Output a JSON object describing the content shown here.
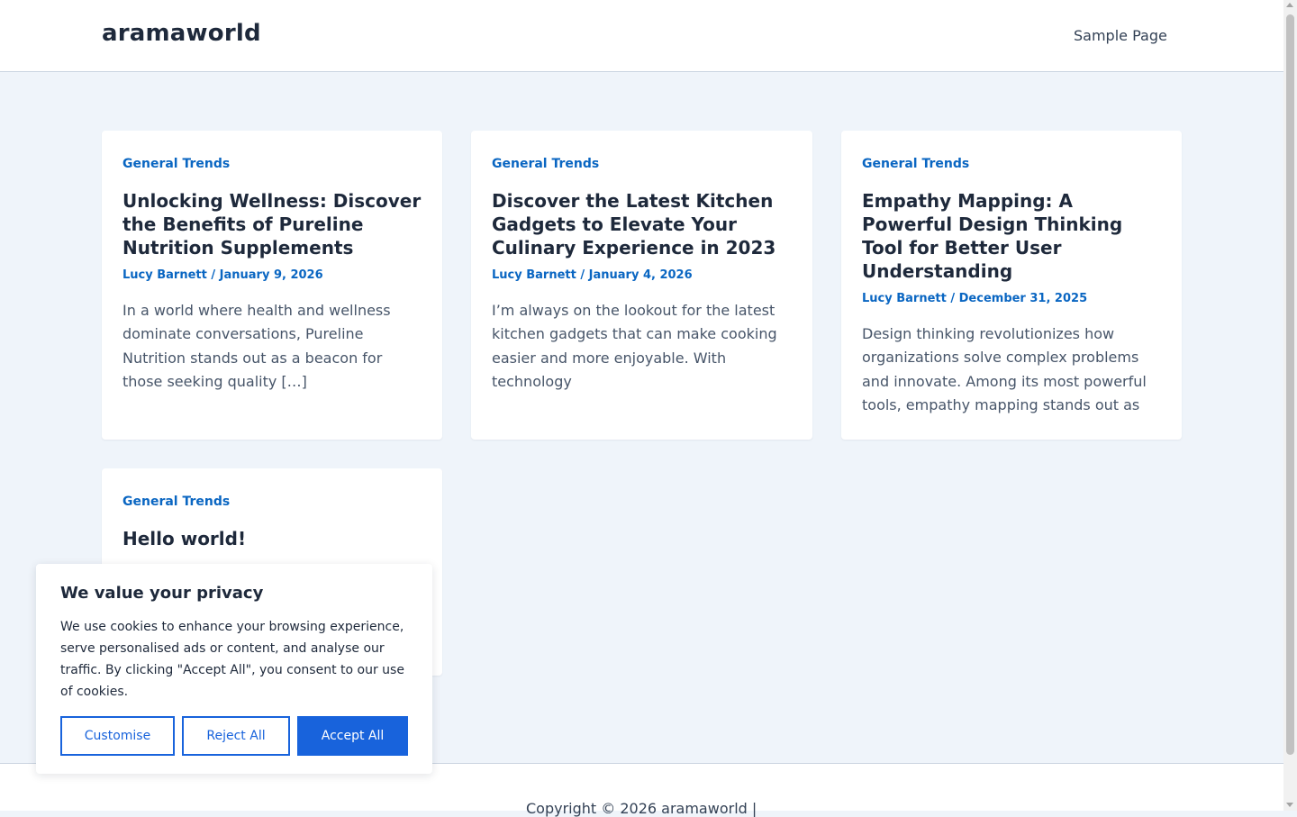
{
  "header": {
    "site_title": "aramaworld",
    "nav": [
      {
        "label": "Sample Page"
      }
    ]
  },
  "posts": [
    {
      "category": "General Trends",
      "title": "Unlocking Wellness: Discover the Benefits of Pureline Nutrition Supplements",
      "meta": "Lucy Barnett / January 9, 2026",
      "excerpt": "In a world where health and wellness dominate conversations, Pureline Nutrition stands out as a beacon for those seeking quality […]"
    },
    {
      "category": "General Trends",
      "title": "Discover the Latest Kitchen Gadgets to Elevate Your Culinary Experience in 2023",
      "meta": "Lucy Barnett / January 4, 2026",
      "excerpt": "I’m always on the lookout for the latest kitchen gadgets that can make cooking easier and more enjoyable. With technology"
    },
    {
      "category": "General Trends",
      "title": "Empathy Mapping: A Powerful Design Thinking Tool for Better User Understanding",
      "meta": "Lucy Barnett / December 31, 2025",
      "excerpt": "Design thinking revolutionizes how organizations solve complex problems and innovate. Among its most powerful tools, empathy mapping stands out as"
    },
    {
      "category": "General Trends",
      "title": "Hello world!",
      "meta": "",
      "excerpt": ""
    }
  ],
  "cookie": {
    "title": "We value your privacy",
    "text": "We use cookies to enhance your browsing experience, serve personalised ads or content, and analyse our traffic. By clicking \"Accept All\", you consent to our use of cookies.",
    "customise_label": "Customise",
    "reject_label": "Reject All",
    "accept_label": "Accept All"
  },
  "footer": {
    "text": "Copyright © 2026 aramaworld |"
  },
  "colors": {
    "accent": "#0a66c2",
    "button_blue": "#1863dc",
    "page_bg": "#eff4fa"
  }
}
